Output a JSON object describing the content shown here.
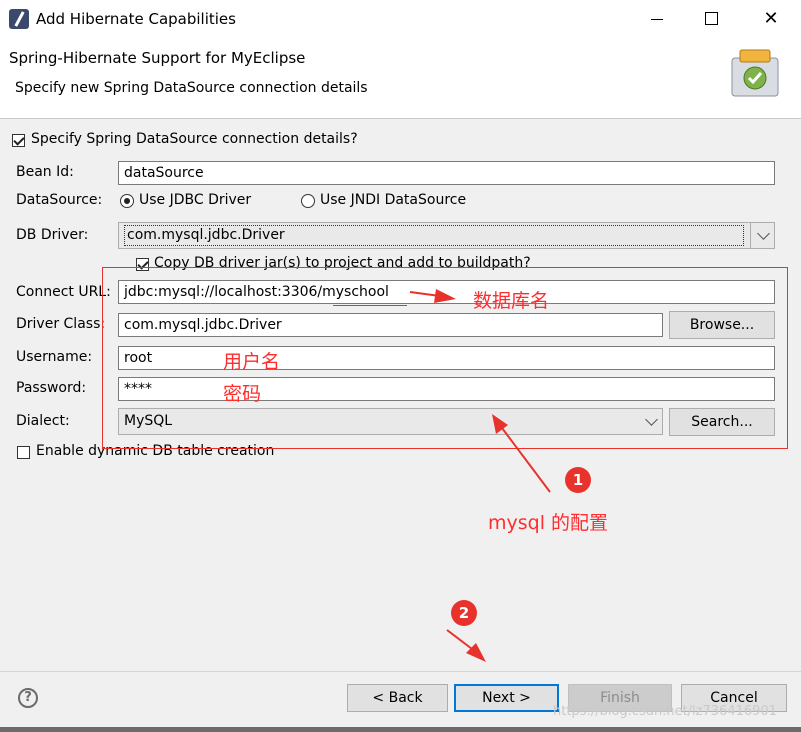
{
  "window": {
    "title": "Add Hibernate Capabilities",
    "close_glyph": "✕"
  },
  "banner": {
    "title": "Spring-Hibernate Support for MyEclipse",
    "subtitle": "Specify new Spring DataSource connection details"
  },
  "form": {
    "specify_checkbox_label": "Specify Spring DataSource connection details?",
    "bean_id_label": "Bean Id:",
    "bean_id_value": "dataSource",
    "datasource_label": "DataSource:",
    "radio_jdbc_label": "Use JDBC Driver",
    "radio_jndi_label": "Use JNDI DataSource",
    "db_driver_label": "DB Driver:",
    "db_driver_value": "com.mysql.jdbc.Driver",
    "copy_jar_label": "Copy DB driver jar(s) to project and add to buildpath?",
    "connect_url_label": "Connect URL:",
    "connect_url_value": "jdbc:mysql://localhost:3306/myschool",
    "driver_class_label": "Driver Class:",
    "driver_class_value": "com.mysql.jdbc.Driver",
    "browse_label": "Browse...",
    "username_label": "Username:",
    "username_value": "root",
    "password_label": "Password:",
    "password_value": "****",
    "dialect_label": "Dialect:",
    "dialect_value": "MySQL",
    "search_label": "Search...",
    "enable_dynamic_label": "Enable dynamic DB table creation"
  },
  "annotations": {
    "database_name": "数据库名",
    "username": "用户名",
    "password": "密码",
    "mysql_config": "mysql 的配置",
    "badge_1": "1",
    "badge_2": "2",
    "color": "#e8322c"
  },
  "footer": {
    "help_glyph": "?",
    "back_label": "< Back",
    "next_label": "Next >",
    "finish_label": "Finish",
    "cancel_label": "Cancel",
    "watermark": "https://blog.csdn.net/lz736416901"
  }
}
